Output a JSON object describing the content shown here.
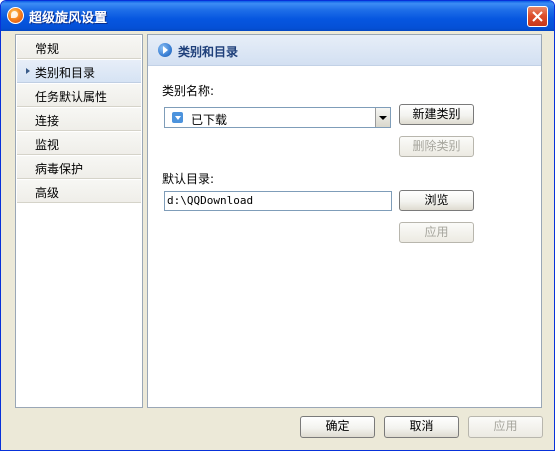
{
  "window": {
    "title": "超级旋风设置"
  },
  "nav": {
    "items": [
      {
        "label": "常规",
        "active": false
      },
      {
        "label": "类别和目录",
        "active": true
      },
      {
        "label": "任务默认属性",
        "active": false
      },
      {
        "label": "连接",
        "active": false
      },
      {
        "label": "监视",
        "active": false
      },
      {
        "label": "病毒保护",
        "active": false
      },
      {
        "label": "高级",
        "active": false
      }
    ]
  },
  "content": {
    "section_title": "类别和目录",
    "category_label": "类别名称:",
    "category_value": "已下载",
    "new_category_button": "新建类别",
    "delete_category_button": "删除类别",
    "default_dir_label": "默认目录:",
    "default_dir_value": "d:\\QQDownload",
    "browse_button": "浏览",
    "apply_button": "应用"
  },
  "footer": {
    "ok": "确定",
    "cancel": "取消",
    "apply": "应用"
  }
}
